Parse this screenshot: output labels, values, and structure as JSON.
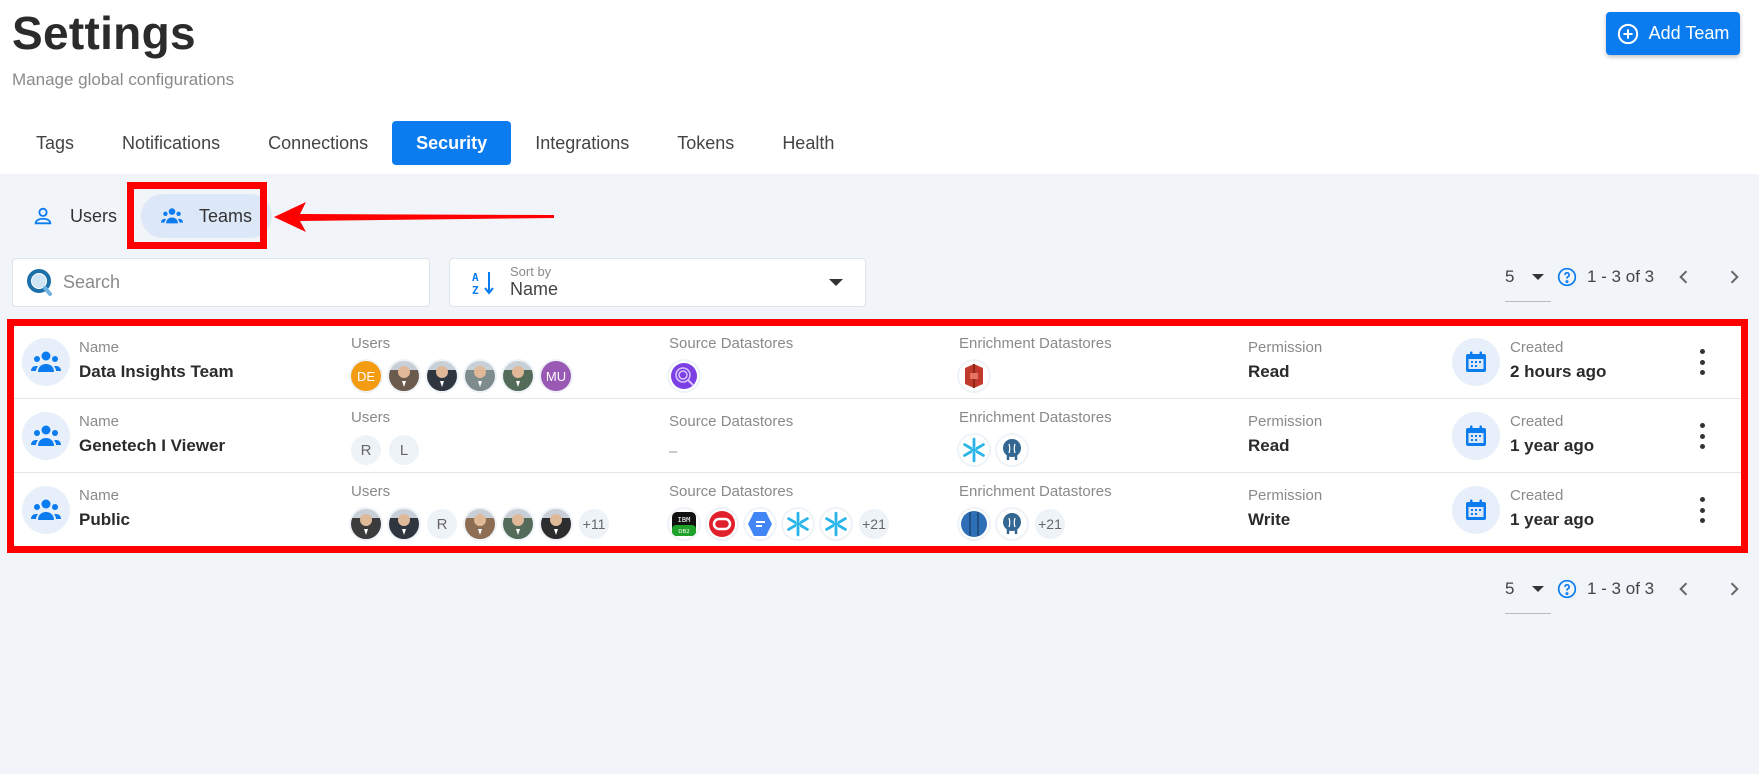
{
  "header": {
    "title": "Settings",
    "subtitle": "Manage global configurations",
    "add_button_label": "Add Team",
    "add_button_icon": "plus-circle-icon"
  },
  "tabs": [
    {
      "label": "Tags",
      "active": false
    },
    {
      "label": "Notifications",
      "active": false
    },
    {
      "label": "Connections",
      "active": false
    },
    {
      "label": "Security",
      "active": true
    },
    {
      "label": "Integrations",
      "active": false
    },
    {
      "label": "Tokens",
      "active": false
    },
    {
      "label": "Health",
      "active": false
    }
  ],
  "subtabs": [
    {
      "label": "Users",
      "icon": "user-icon",
      "active": false
    },
    {
      "label": "Teams",
      "icon": "team-icon",
      "active": true
    }
  ],
  "toolbar": {
    "search_placeholder": "Search",
    "search_value": "",
    "sort_label": "Sort by",
    "sort_value": "Name"
  },
  "pagination": {
    "page_size": "5",
    "range": "1 - 3 of 3"
  },
  "columns": {
    "name": "Name",
    "users": "Users",
    "source": "Source Datastores",
    "enrichment": "Enrichment Datastores",
    "permission": "Permission",
    "created": "Created"
  },
  "teams": [
    {
      "name": "Data Insights Team",
      "users": [
        {
          "type": "initials",
          "text": "DE",
          "color": "#f39c12"
        },
        {
          "type": "photo",
          "color": "#6b5a4e"
        },
        {
          "type": "photo",
          "color": "#2f3640"
        },
        {
          "type": "photo",
          "color": "#7f8c8d"
        },
        {
          "type": "photo",
          "color": "#556b5a"
        },
        {
          "type": "initials",
          "text": "MU",
          "color": "#9b59b6"
        }
      ],
      "source_datastores": [
        {
          "icon": "qualytics-icon",
          "color": "#7b3fe4"
        }
      ],
      "source_empty": "",
      "enrichment_datastores": [
        {
          "icon": "amazon-s3-icon",
          "color": "#c0392b"
        }
      ],
      "permission": "Read",
      "created": "2 hours ago"
    },
    {
      "name": "Genetech I Viewer",
      "users": [
        {
          "type": "initials-light",
          "text": "R"
        },
        {
          "type": "initials-light",
          "text": "L"
        }
      ],
      "source_datastores": [],
      "source_empty": "–",
      "enrichment_datastores": [
        {
          "icon": "snowflake-icon",
          "color": "#29b5e8"
        },
        {
          "icon": "postgresql-icon",
          "color": "#336791"
        }
      ],
      "permission": "Read",
      "created": "1 year ago"
    },
    {
      "name": "Public",
      "users": [
        {
          "type": "photo",
          "color": "#3b3b3b"
        },
        {
          "type": "photo",
          "color": "#2f3640"
        },
        {
          "type": "initials-light",
          "text": "R"
        },
        {
          "type": "photo",
          "color": "#8e6e53"
        },
        {
          "type": "photo",
          "color": "#556b5a"
        },
        {
          "type": "photo",
          "color": "#2d2d2d"
        },
        {
          "type": "more",
          "text": "+11"
        }
      ],
      "source_datastores": [
        {
          "icon": "ibm-db2-icon",
          "color": "#1fa12a"
        },
        {
          "icon": "oracle-icon",
          "color": "#e0202a"
        },
        {
          "icon": "google-bigquery-icon",
          "color": "#4285f4"
        },
        {
          "icon": "snowflake-icon",
          "color": "#29b5e8"
        },
        {
          "icon": "snowflake-icon",
          "color": "#29b5e8"
        },
        {
          "icon": "more",
          "text": "+21"
        }
      ],
      "source_empty": "",
      "enrichment_datastores": [
        {
          "icon": "amazon-redshift-icon",
          "color": "#2e6fb7"
        },
        {
          "icon": "postgresql-icon",
          "color": "#336791"
        },
        {
          "icon": "more",
          "text": "+21"
        }
      ],
      "permission": "Write",
      "created": "1 year ago"
    }
  ],
  "colors": {
    "accent": "#0a7cf0",
    "annotation": "#ff0000",
    "background": "#f1f5f9"
  }
}
